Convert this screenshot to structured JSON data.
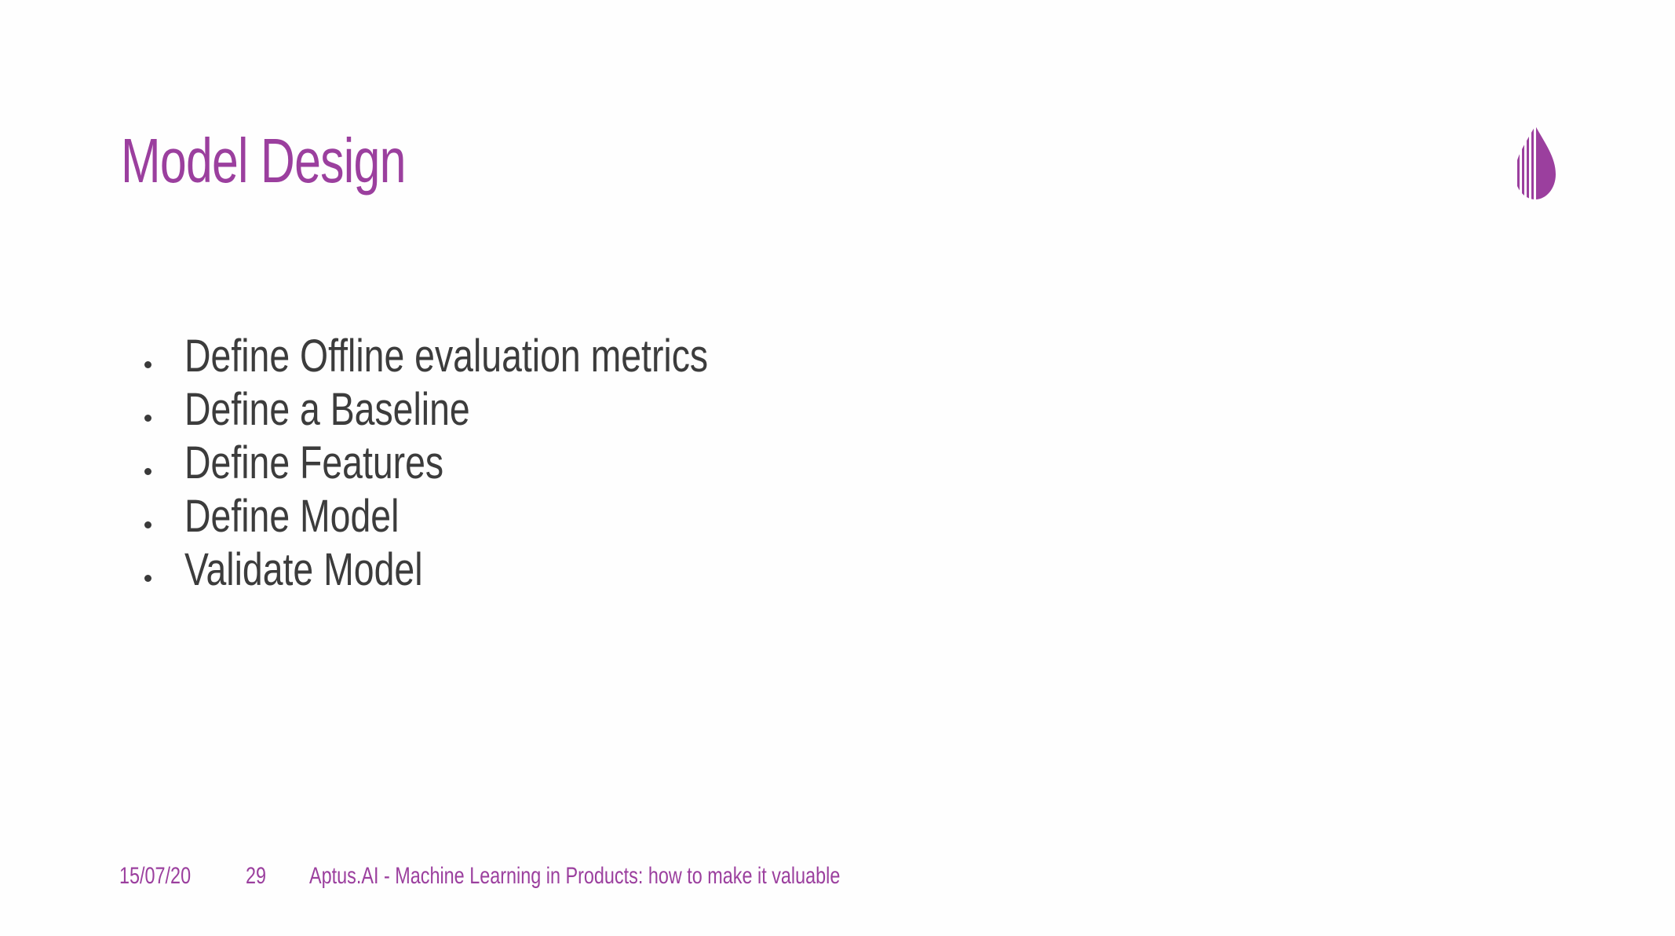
{
  "colors": {
    "accent": "#9b3f9e",
    "text": "#3c3c3c",
    "background": "#fefefe"
  },
  "slide": {
    "title": "Model Design",
    "logo_icon": "aptus-drop-logo-icon",
    "bullets": [
      {
        "text": "Define Offline evaluation metrics"
      },
      {
        "text": "Define a Baseline"
      },
      {
        "text": "Define Features"
      },
      {
        "text": "Define Model"
      },
      {
        "text": "Validate Model"
      }
    ]
  },
  "footer": {
    "date": "15/07/20",
    "page_number": "29",
    "presentation_title": "Aptus.AI - Machine Learning in Products: how to make it valuable"
  }
}
